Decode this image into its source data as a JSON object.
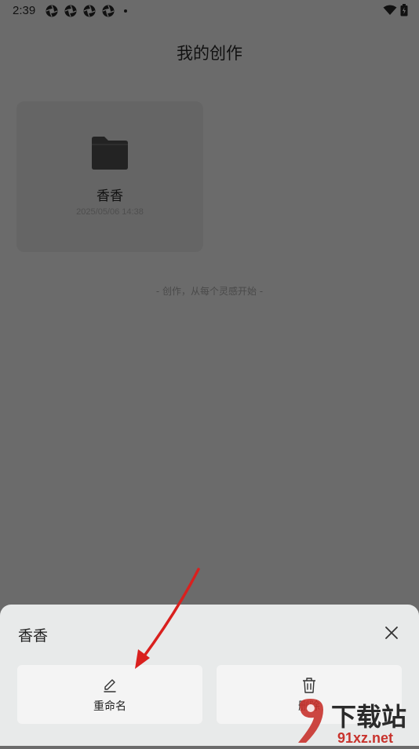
{
  "status_bar": {
    "time": "2:39"
  },
  "header": {
    "title": "我的创作"
  },
  "project_card": {
    "name": "香香",
    "date": "2025/05/06 14:38"
  },
  "empty_hint": "- 创作，从每个灵感开始 -",
  "bottom_sheet": {
    "title": "香香",
    "rename_label": "重命名",
    "delete_label": "删除"
  },
  "watermark": {
    "text_main": "下载站",
    "text_sub": "91xz.net"
  },
  "colors": {
    "overlay": "#6b6b6b",
    "sheet": "#e8eaea",
    "arrow": "#d9201e",
    "watermark": "#c8332d"
  },
  "icons": [
    "shutter-icon",
    "wifi-icon",
    "battery-icon",
    "folder-icon",
    "close-icon",
    "pencil-icon",
    "trash-icon"
  ]
}
